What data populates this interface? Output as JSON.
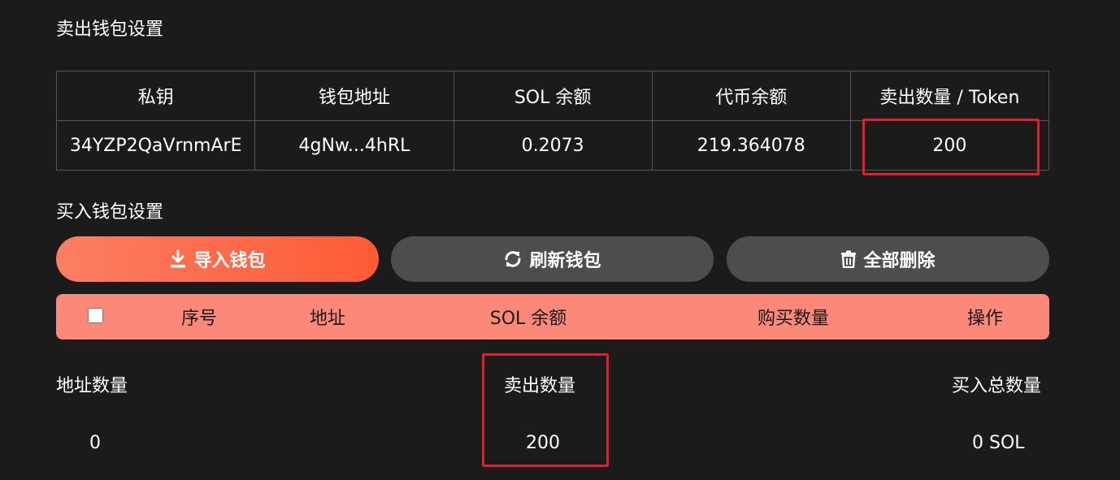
{
  "sell_section": {
    "title": "卖出钱包设置",
    "headers": [
      "私钥",
      "钱包地址",
      "SOL 余额",
      "代币余额",
      "卖出数量 / Token"
    ],
    "row": [
      "34YZP2QaVrnmArE",
      "4gNw...4hRL",
      "0.2073",
      "219.364078",
      "200"
    ]
  },
  "buy_section": {
    "title": "买入钱包设置",
    "buttons": {
      "import": "导入钱包",
      "refresh": "刷新钱包",
      "delete_all": "全部删除"
    },
    "table_headers": {
      "index": "序号",
      "address": "地址",
      "sol_balance": "SOL 余额",
      "buy_amount": "购买数量",
      "actions": "操作"
    }
  },
  "summary": {
    "address_count_label": "地址数量",
    "address_count_value": "0",
    "sell_amount_label": "卖出数量",
    "sell_amount_value": "200",
    "buy_total_label": "买入总数量",
    "buy_total_value": "0 SOL"
  },
  "colors": {
    "background": "#1b1b1b",
    "accent_gradient_start": "#fb7e63",
    "accent_gradient_end": "#ff5a35",
    "header_row": "#fb8878",
    "secondary_button": "#4d4d4d",
    "highlight": "#e0202a"
  }
}
